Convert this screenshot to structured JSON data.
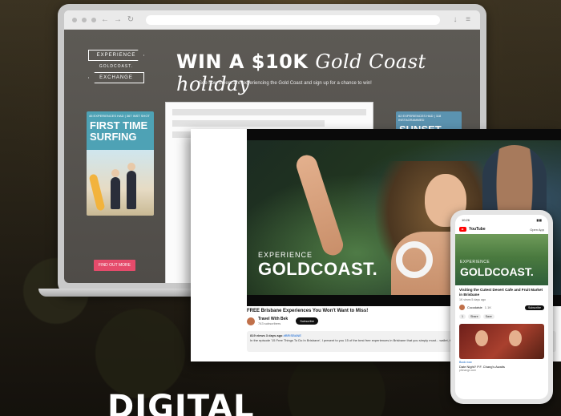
{
  "laptop_site": {
    "logo_lines": [
      "EXPERIENCE",
      "GOLDCOAST.",
      "EXCHANGE"
    ],
    "title_bold": "WIN A $10K",
    "title_script": "Gold Coast holiday",
    "subtitle": "See how others are experiencing the Gold Coast and sign up for a chance to win!",
    "left_card": {
      "tag": "45 EXPERIENCES HAD | 367 INST SHOT",
      "headline": "FIRST TIME SURFING"
    },
    "right_card": {
      "tag": "62 EXPERIENCES HAD | 118 INSTAGRAMMED",
      "headline": "SUNSET"
    },
    "cta": "FIND OUT MORE"
  },
  "youtube": {
    "overlay_small": "EXPERIENCE",
    "overlay_big": "GOLDCOAST.",
    "video_title": "FREE Brisbane Experiences You Won't Want to Miss!",
    "channel_name": "Travel With Bek",
    "channel_subs": "743 subscribers",
    "subscribe_label": "Subscribe",
    "views": "819 views  3 days ago",
    "hashtag": "#BRISBANE",
    "description": "In the episode '15 Free Things To Do In Brisbane', I present to you 15 of the best free experiences in Brisbane that you simply must... wallet, then you're in the perfect spot!"
  },
  "phone": {
    "time": "10:26",
    "app_name": "YouTube",
    "open_app": "Open App",
    "overlay_small": "EXPERIENCE",
    "overlay_big": "GOLDCOAST.",
    "video_title": "Visiting the Cutest Desert Cafe and Fruit Market in Brisbane",
    "meta": "1K views  5 days ago",
    "channel_name": "Cocodaisie",
    "channel_subs": "1.1K",
    "subscribe_label": "Subscribe",
    "actions": [
      "1",
      "Share",
      "Save"
    ],
    "book_now": "Book now",
    "ad_title": "Date Night? P.F. Chang's Awaits",
    "ad_url": "pfchangs.com"
  },
  "heading": "DIGITAL"
}
